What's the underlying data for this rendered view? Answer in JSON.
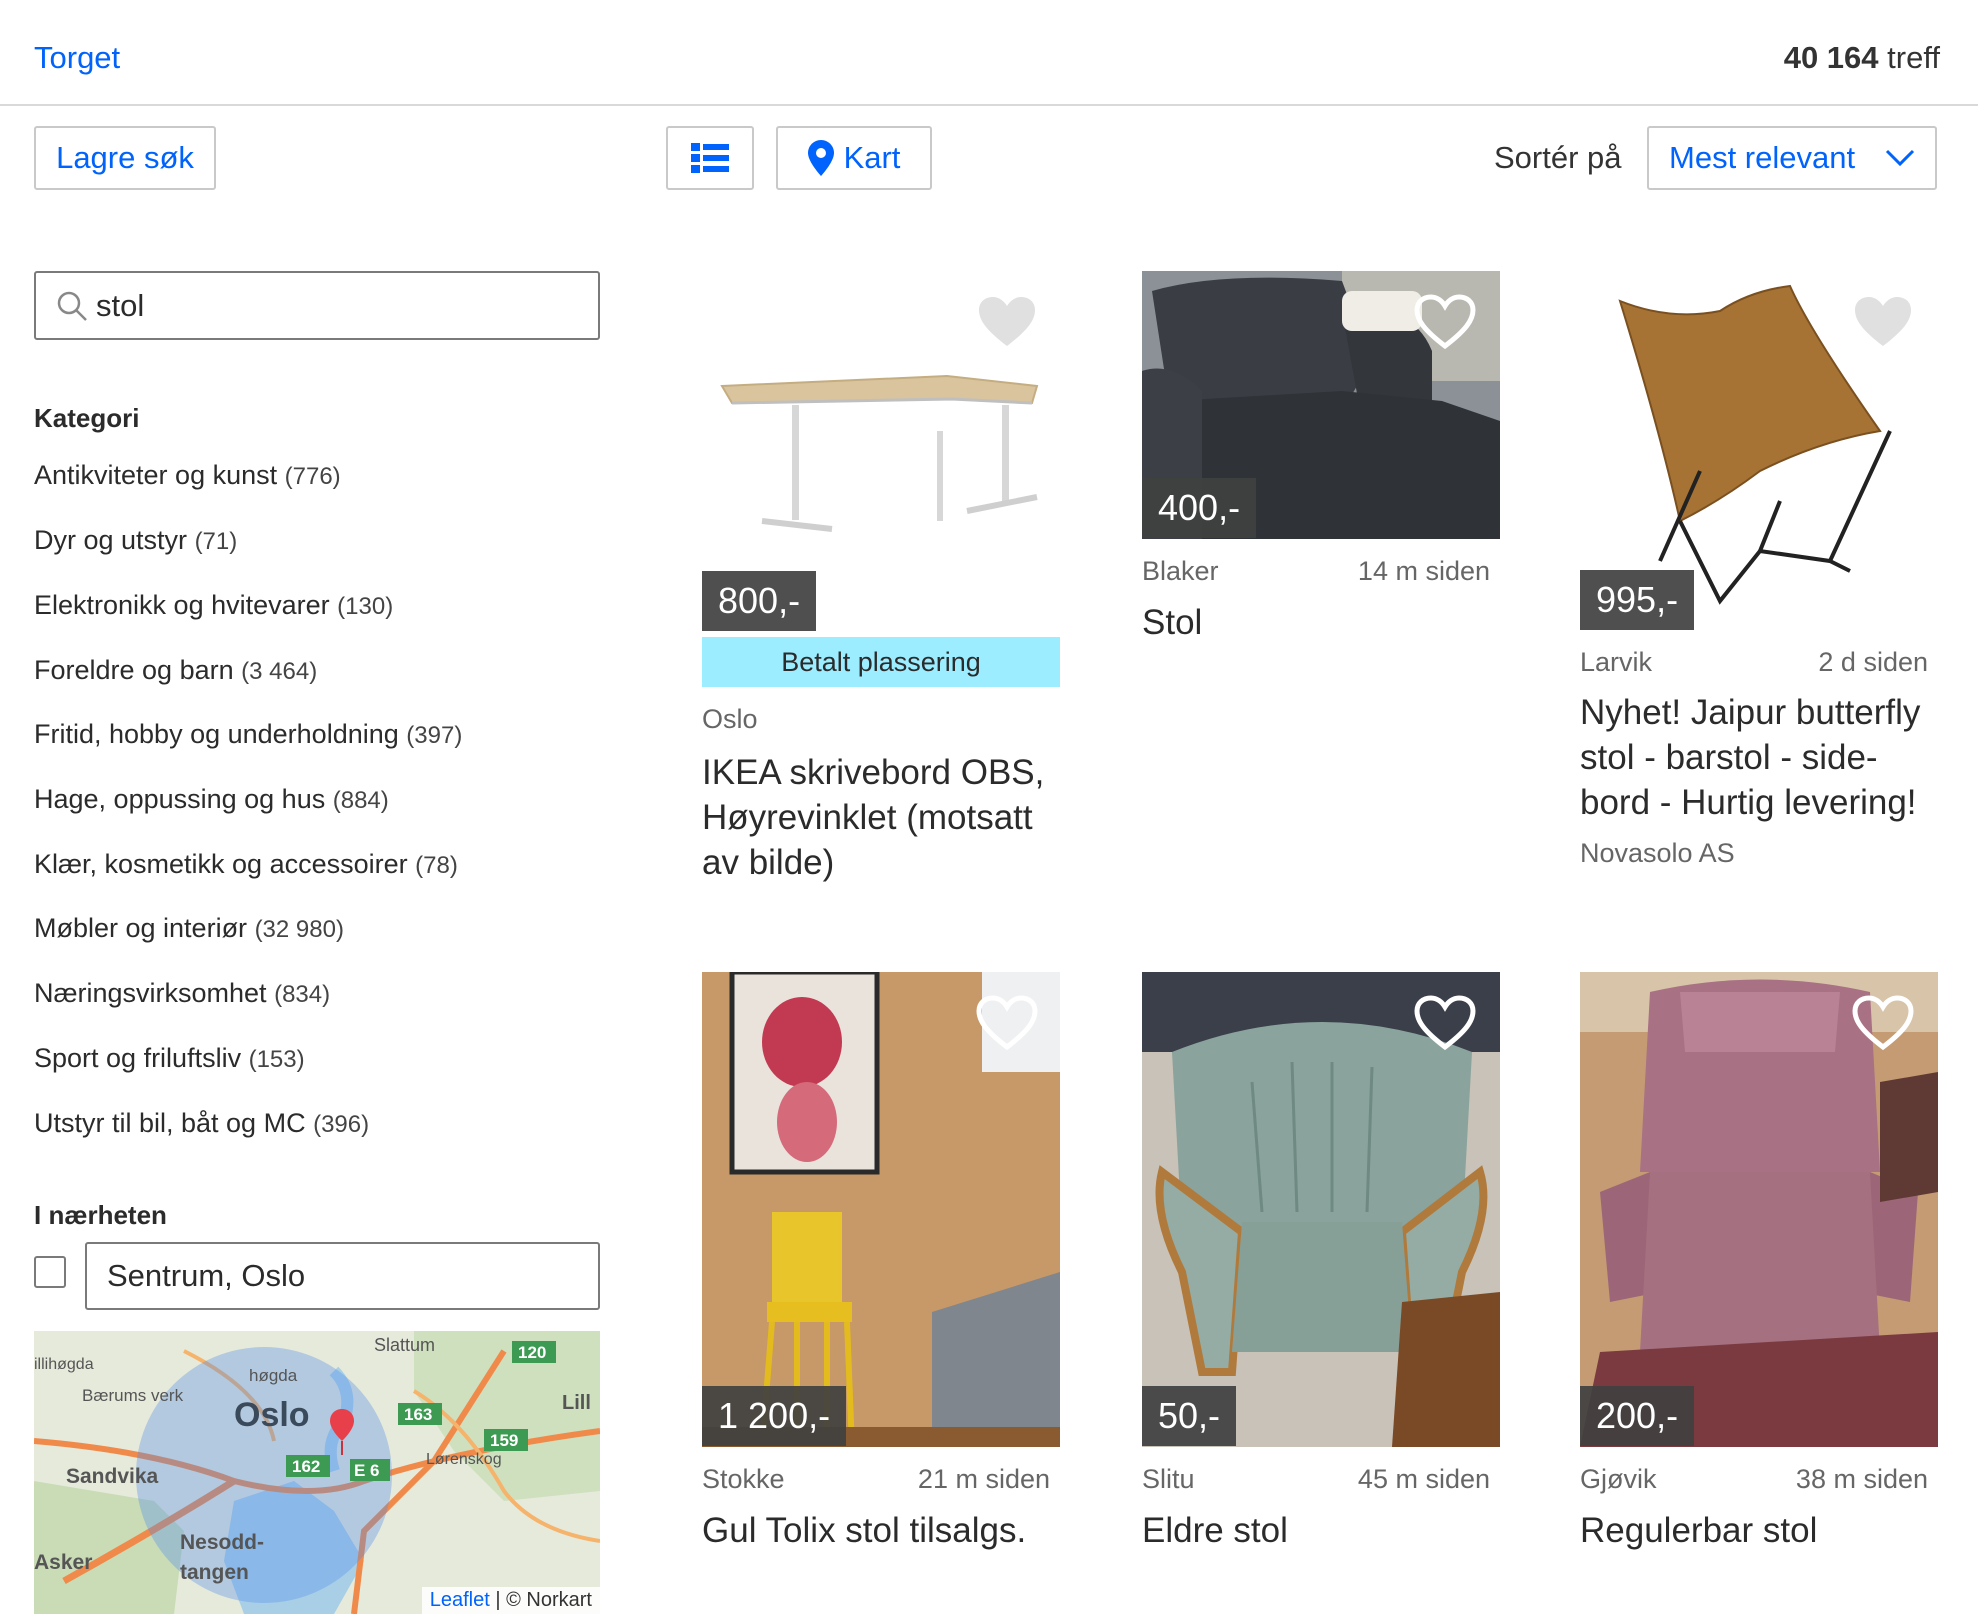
{
  "header": {
    "breadcrumb": "Torget",
    "hit_count": "40 164",
    "hit_suffix": "treff"
  },
  "toolbar": {
    "save_search_label": "Lagre søk",
    "map_label": "Kart",
    "sort_label": "Sortér på",
    "sort_value": "Mest relevant"
  },
  "search": {
    "value": "stol"
  },
  "filters": {
    "category_heading": "Kategori",
    "categories": [
      {
        "label": "Antikviteter og kunst",
        "count": "(776)"
      },
      {
        "label": "Dyr og utstyr",
        "count": "(71)"
      },
      {
        "label": "Elektronikk og hvitevarer",
        "count": "(130)"
      },
      {
        "label": "Foreldre og barn",
        "count": "(3 464)"
      },
      {
        "label": "Fritid, hobby og underholdning",
        "count": "(397)"
      },
      {
        "label": "Hage, oppussing og hus",
        "count": "(884)"
      },
      {
        "label": "Klær, kosmetikk og accessoirer",
        "count": "(78)"
      },
      {
        "label": "Møbler og interiør",
        "count": "(32 980)"
      },
      {
        "label": "Næringsvirksomhet",
        "count": "(834)"
      },
      {
        "label": "Sport og friluftsliv",
        "count": "(153)"
      },
      {
        "label": "Utstyr til bil, båt og MC",
        "count": "(396)"
      }
    ],
    "nearby_heading": "I nærheten",
    "nearby_location": "Sentrum, Oslo"
  },
  "map": {
    "labels": [
      "Slattum",
      "Bærums verk",
      "høgda",
      "Oslo",
      "Sandvika",
      "Lørenskog",
      "Nesodd-",
      "tangen",
      "Asker",
      "illihøgda",
      "Lill"
    ],
    "road_signs": [
      "120",
      "163",
      "162",
      "E 6",
      "159"
    ],
    "attribution_link": "Leaflet",
    "attribution_text": "| © Norkart"
  },
  "listings": [
    {
      "price": "800,-",
      "badge": "Betalt plassering",
      "location": "Oslo",
      "age": "",
      "title_lines": [
        "IKEA skrivebord OBS,",
        "Høyrevinklet (motsatt",
        "av bilde)"
      ],
      "seller": ""
    },
    {
      "price": "400,-",
      "badge": "",
      "location": "Blaker",
      "age": "14 m siden",
      "title_lines": [
        "Stol"
      ],
      "seller": ""
    },
    {
      "price": "995,-",
      "badge": "",
      "location": "Larvik",
      "age": "2 d siden",
      "title_lines": [
        "Nyhet! Jaipur butterfly",
        "stol - barstol - side-",
        "bord - Hurtig levering!"
      ],
      "seller": "Novasolo AS"
    },
    {
      "price": "1 200,-",
      "badge": "",
      "location": "Stokke",
      "age": "21 m siden",
      "title_lines": [
        "Gul Tolix stol tilsalgs."
      ],
      "seller": ""
    },
    {
      "price": "50,-",
      "badge": "",
      "location": "Slitu",
      "age": "45 m siden",
      "title_lines": [
        "Eldre stol"
      ],
      "seller": ""
    },
    {
      "price": "200,-",
      "badge": "",
      "location": "Gjøvik",
      "age": "38 m siden",
      "title_lines": [
        "Regulerbar stol"
      ],
      "seller": ""
    }
  ],
  "colors": {
    "link": "#0063fb",
    "paid_badge": "#9bedff",
    "price_tag": "#404040"
  }
}
